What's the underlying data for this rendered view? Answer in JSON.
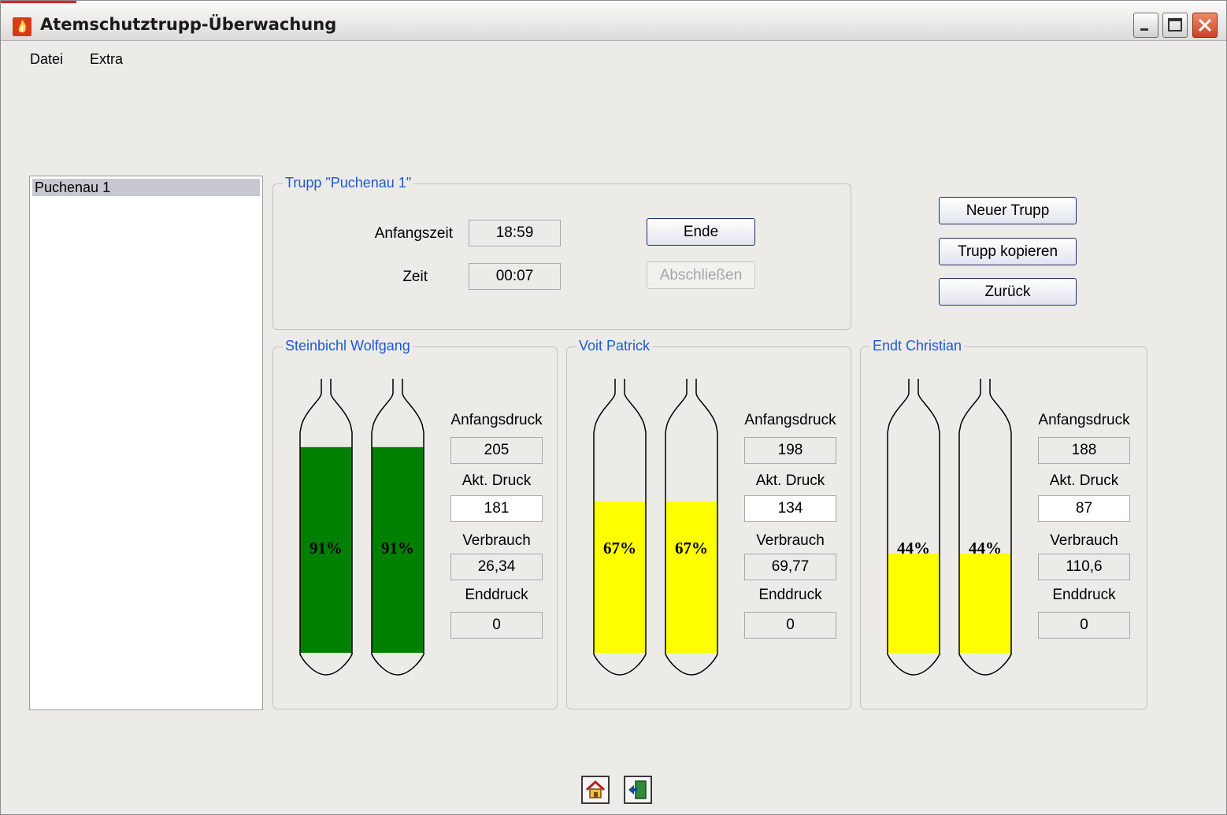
{
  "window": {
    "title": "Atemschutztrupp-Überwachung",
    "icons": {
      "app": "fire-icon",
      "minimize": "minimize-icon",
      "maximize": "maximize-icon",
      "close": "close-icon"
    }
  },
  "menu": {
    "datei": "Datei",
    "extra": "Extra"
  },
  "trupp_list": {
    "items": [
      "Puchenau 1"
    ],
    "selected": "Puchenau 1"
  },
  "trupp": {
    "title": "Trupp \"Puchenau 1\"",
    "anfangszeit_label": "Anfangszeit",
    "anfangszeit": "18:59",
    "zeit_label": "Zeit",
    "zeit": "00:07",
    "ende_label": "Ende",
    "abschliessen_label": "Abschließen"
  },
  "actions": {
    "neuer_trupp": "Neuer Trupp",
    "trupp_kopieren": "Trupp kopieren",
    "zurueck": "Zurück"
  },
  "members": [
    {
      "name": "Steinbichl Wolfgang",
      "percent_label": "91%",
      "fill_fraction": 0.91,
      "fill_color": "#008000",
      "anfangsdruck_label": "Anfangsdruck",
      "anfangsdruck": "205",
      "akt_druck_label": "Akt. Druck",
      "akt_druck": "181",
      "verbrauch_label": "Verbrauch",
      "verbrauch": "26,34",
      "enddruck_label": "Enddruck",
      "enddruck": "0"
    },
    {
      "name": "Voit Patrick",
      "percent_label": "67%",
      "fill_fraction": 0.67,
      "fill_color": "#ffff00",
      "anfangsdruck_label": "Anfangsdruck",
      "anfangsdruck": "198",
      "akt_druck_label": "Akt. Druck",
      "akt_druck": "134",
      "verbrauch_label": "Verbrauch",
      "verbrauch": "69,77",
      "enddruck_label": "Enddruck",
      "enddruck": "0"
    },
    {
      "name": "Endt Christian",
      "percent_label": "44%",
      "fill_fraction": 0.44,
      "fill_color": "#ffff00",
      "anfangsdruck_label": "Anfangsdruck",
      "anfangsdruck": "188",
      "akt_druck_label": "Akt. Druck",
      "akt_druck": "87",
      "verbrauch_label": "Verbrauch",
      "verbrauch": "110,6",
      "enddruck_label": "Enddruck",
      "enddruck": "0"
    }
  ],
  "bottom_icons": {
    "home": "home-icon",
    "exit": "exit-door-icon"
  }
}
